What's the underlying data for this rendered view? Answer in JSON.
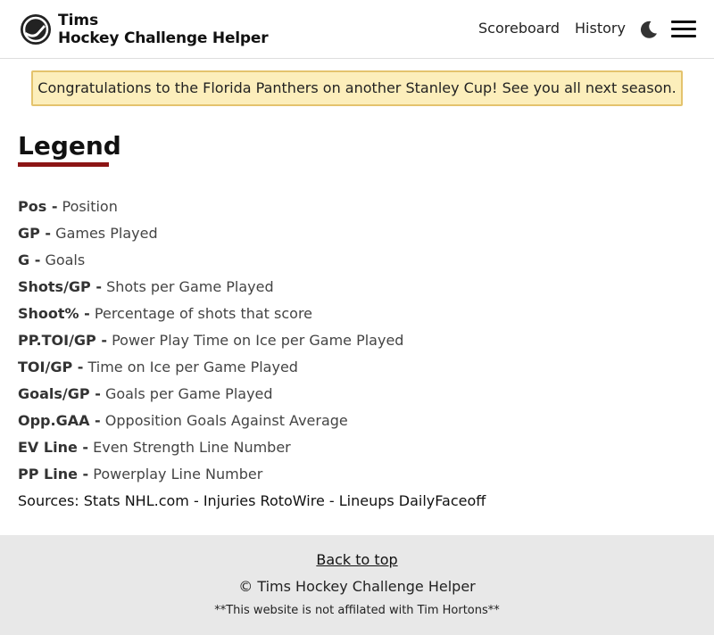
{
  "header": {
    "brand_line1": "Tims",
    "brand_line2": "Hockey Challenge Helper",
    "nav": {
      "scoreboard": "Scoreboard",
      "history": "History"
    },
    "icons": {
      "logo": "puck-logo-icon",
      "theme": "moon-icon",
      "menu": "hamburger-menu-icon"
    }
  },
  "banner": {
    "text": "Congratulations to the Florida Panthers on another Stanley Cup! See you all next season."
  },
  "legend": {
    "title": "Legend",
    "items": [
      {
        "term": "Pos -",
        "desc": "Position"
      },
      {
        "term": "GP -",
        "desc": "Games Played"
      },
      {
        "term": "G -",
        "desc": "Goals"
      },
      {
        "term": "Shots/GP -",
        "desc": "Shots per Game Played"
      },
      {
        "term": "Shoot% -",
        "desc": "Percentage of shots that score"
      },
      {
        "term": "PP.TOI/GP -",
        "desc": "Power Play Time on Ice per Game Played"
      },
      {
        "term": "TOI/GP -",
        "desc": "Time on Ice per Game Played"
      },
      {
        "term": "Goals/GP -",
        "desc": "Goals per Game Played"
      },
      {
        "term": "Opp.GAA -",
        "desc": "Opposition Goals Against Average"
      },
      {
        "term": "EV Line -",
        "desc": "Even Strength Line Number"
      },
      {
        "term": "PP Line -",
        "desc": "Powerplay Line Number"
      }
    ],
    "sources": "Sources: Stats NHL.com - Injuries RotoWire - Lineups DailyFaceoff"
  },
  "footer": {
    "back_to_top": "Back to top",
    "copyright": "© Tims Hockey Challenge Helper",
    "disclaimer": "**This website is not affilated with Tim Hortons**"
  },
  "colors": {
    "accent_underline": "#8c1515",
    "banner_bg": "#fceebb",
    "banner_border": "#e4c36d",
    "footer_bg": "#e8e8e8"
  }
}
